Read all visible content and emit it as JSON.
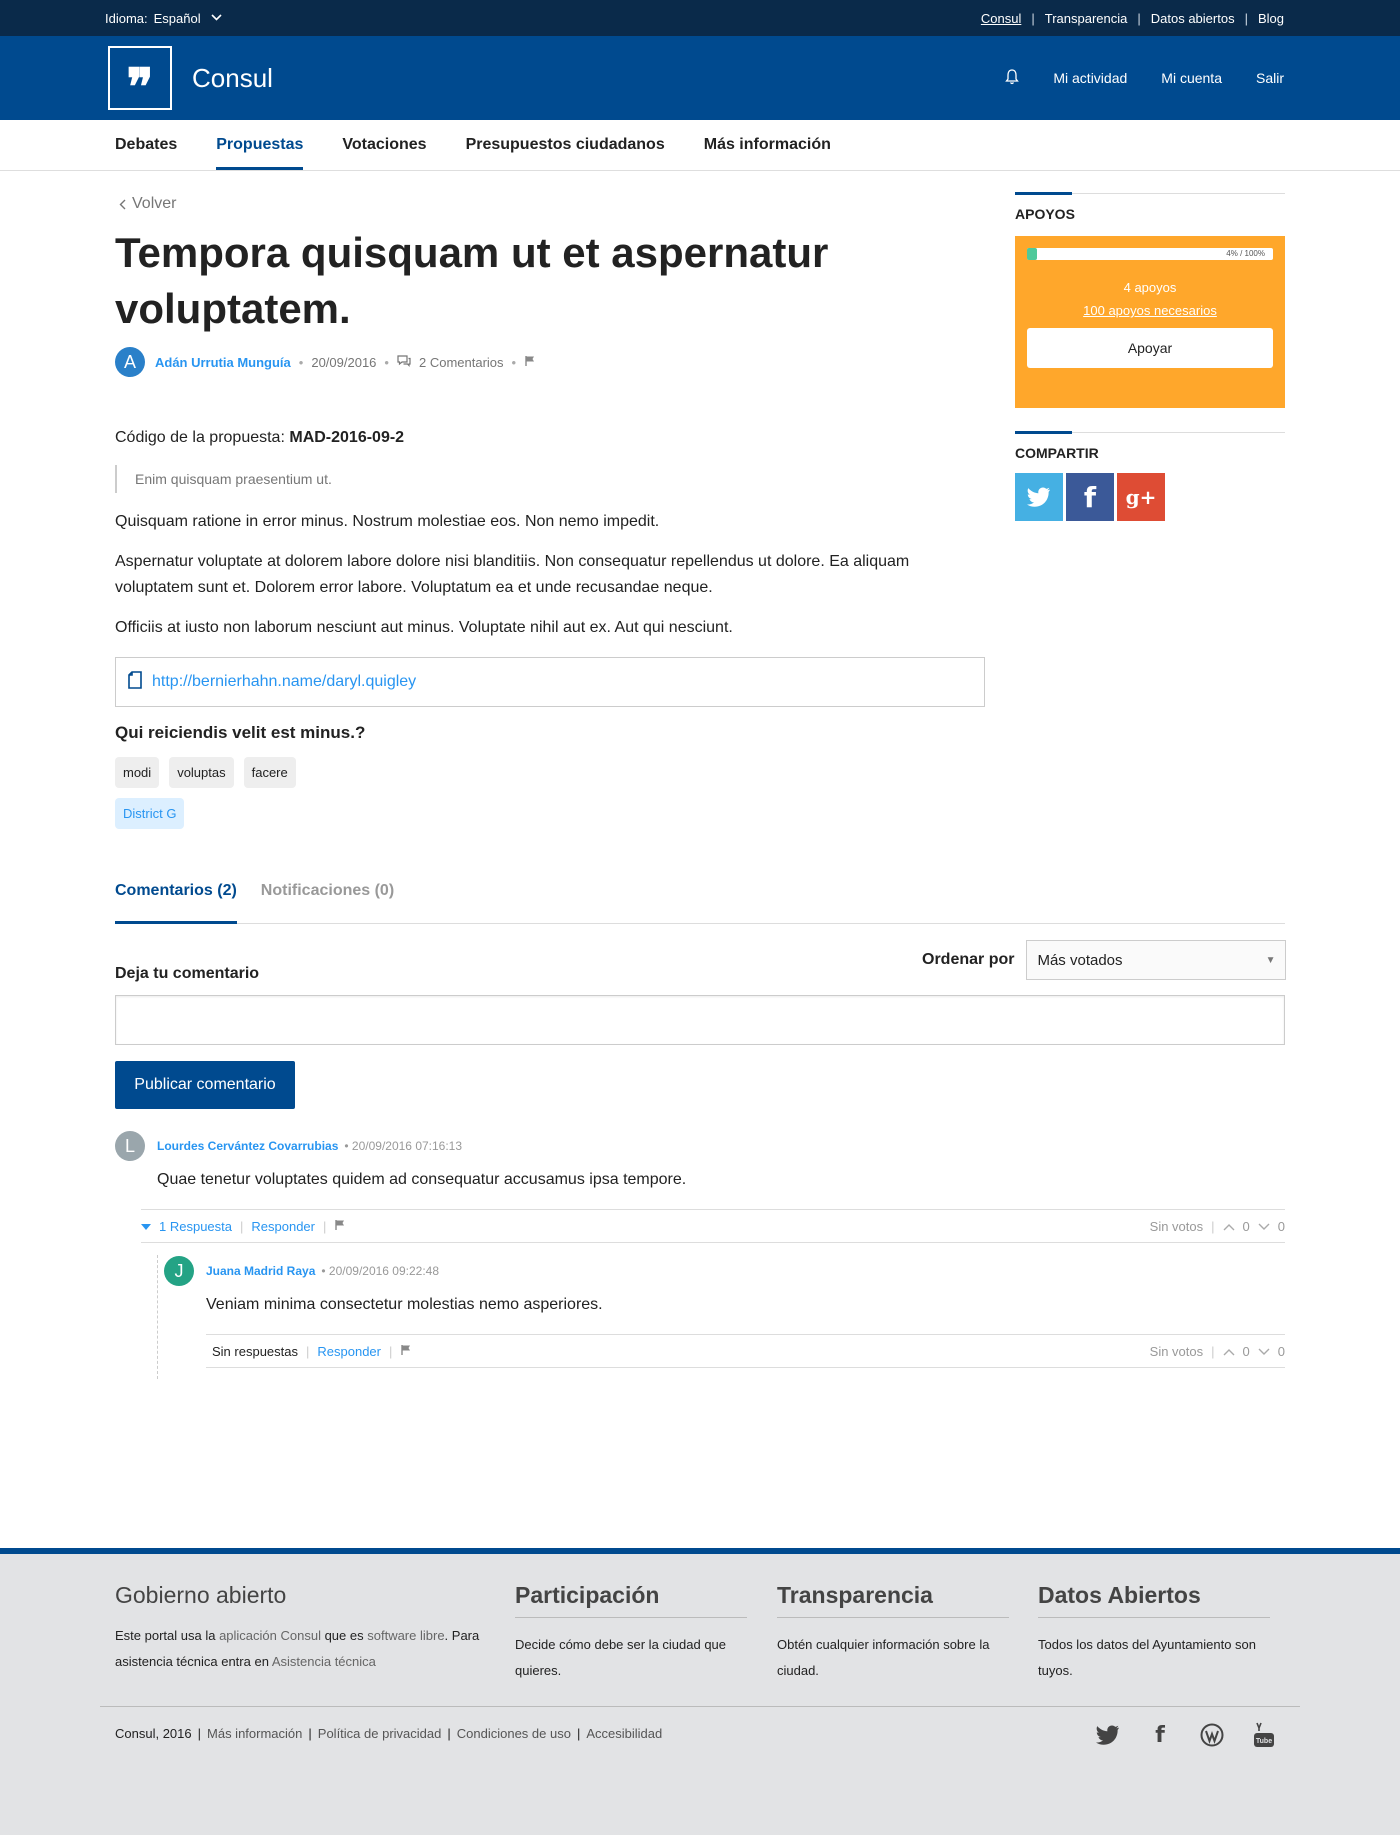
{
  "topbar": {
    "language_label": "Idioma:",
    "language_value": "Español",
    "links": [
      "Consul",
      "Transparencia",
      "Datos abiertos",
      "Blog"
    ]
  },
  "header": {
    "logo_glyph": "❞",
    "brand": "Consul",
    "nav": [
      "Mi actividad",
      "Mi cuenta",
      "Salir"
    ]
  },
  "mainnav": {
    "items": [
      "Debates",
      "Propuestas",
      "Votaciones",
      "Presupuestos ciudadanos",
      "Más información"
    ],
    "active": "Propuestas"
  },
  "proposal": {
    "back": "Volver",
    "title": "Tempora quisquam ut et aspernatur voluptatem.",
    "author_initial": "A",
    "author": "Adán Urrutia Munguía",
    "date": "20/09/2016",
    "comments_count": "2 Comentarios",
    "code_label": "Código de la propuesta:",
    "code_value": "MAD-2016-09-2",
    "summary": "Enim quisquam praesentium ut.",
    "paragraphs": [
      "Quisquam ratione in error minus. Nostrum molestiae eos. Non nemo impedit.",
      "Aspernatur voluptate at dolorem labore dolore nisi blanditiis. Non consequatur repellendus ut dolore. Ea aliquam voluptatem sunt et. Dolorem error labore. Voluptatum ea et unde recusandae neque.",
      "Officiis at iusto non laborum nesciunt aut minus. Voluptate nihil aut ex. Aut qui nesciunt."
    ],
    "document_link": "http://bernierhahn.name/daryl.quigley",
    "question": "Qui reiciendis velit est minus.?",
    "tags": [
      "modi",
      "voluptas",
      "facere"
    ],
    "geozone": "District G"
  },
  "sidebar": {
    "supports_title": "APOYOS",
    "progress_fraction": 0.04,
    "progress_label": "4% / 100%",
    "supports": "4 apoyos",
    "needed": "100 apoyos necesarios",
    "support_button": "Apoyar",
    "share_title": "COMPARTIR",
    "share": [
      {
        "icon": "twitter-icon",
        "glyph": "🐦",
        "color": "#45b0e3"
      },
      {
        "icon": "facebook-icon",
        "glyph": "f",
        "color": "#3b5998"
      },
      {
        "icon": "googleplus-icon",
        "glyph": "g+",
        "color": "#de4c34"
      }
    ]
  },
  "tabs": {
    "comments": "Comentarios (2)",
    "notifications": "Notificaciones (0)"
  },
  "comments_section": {
    "order_label": "Ordenar por",
    "order_value": "Más votados",
    "leave_label": "Deja tu comentario",
    "publish_button": "Publicar comentario",
    "comments": [
      {
        "initial": "L",
        "avatar_color": "#9aa6ac",
        "author": "Lourdes Cervántez Covarrubias",
        "date": "• 20/09/2016 07:16:13",
        "body": "Quae tenetur voluptates quidem ad consequatur accusamus ipsa tempore.",
        "responses": "1 Respuesta",
        "reply": "Responder",
        "votes_label": "Sin votos",
        "up": "0",
        "down": "0"
      },
      {
        "initial": "J",
        "avatar_color": "#24a385",
        "author": "Juana Madrid Raya",
        "date": "• 20/09/2016 09:22:48",
        "body": "Veniam minima consectetur molestias nemo asperiores.",
        "responses": "Sin respuestas",
        "reply": "Responder",
        "votes_label": "Sin votos",
        "up": "0",
        "down": "0"
      }
    ]
  },
  "footer": {
    "col1_title": "Gobierno abierto",
    "col1_text_1": "Este portal usa la ",
    "col1_link_1": "aplicación Consul",
    "col1_text_2": " que es ",
    "col1_link_2": "software libre",
    "col1_text_3": ". Para asistencia técnica entra en ",
    "col1_link_3": "Asistencia técnica",
    "col2_title": "Participación",
    "col2_text": "Decide cómo debe ser la ciudad que quieres.",
    "col3_title": "Transparencia",
    "col3_text": "Obtén cualquier información sobre la ciudad.",
    "col4_title": "Datos Abiertos",
    "col4_text": "Todos los datos del Ayuntamiento son tuyos.",
    "copyright": "Consul, 2016",
    "links": [
      "Más información",
      "Política de privacidad",
      "Condiciones de uso",
      "Accesibilidad"
    ],
    "social": [
      "twitter-icon",
      "facebook-icon",
      "wordpress-icon",
      "youtube-icon"
    ]
  },
  "colors": {
    "primary": "#004a8f",
    "topbar": "#0a2a4a",
    "link": "#2895f1",
    "support_box": "#ffa72b",
    "progress_fill": "#4fc99a"
  }
}
